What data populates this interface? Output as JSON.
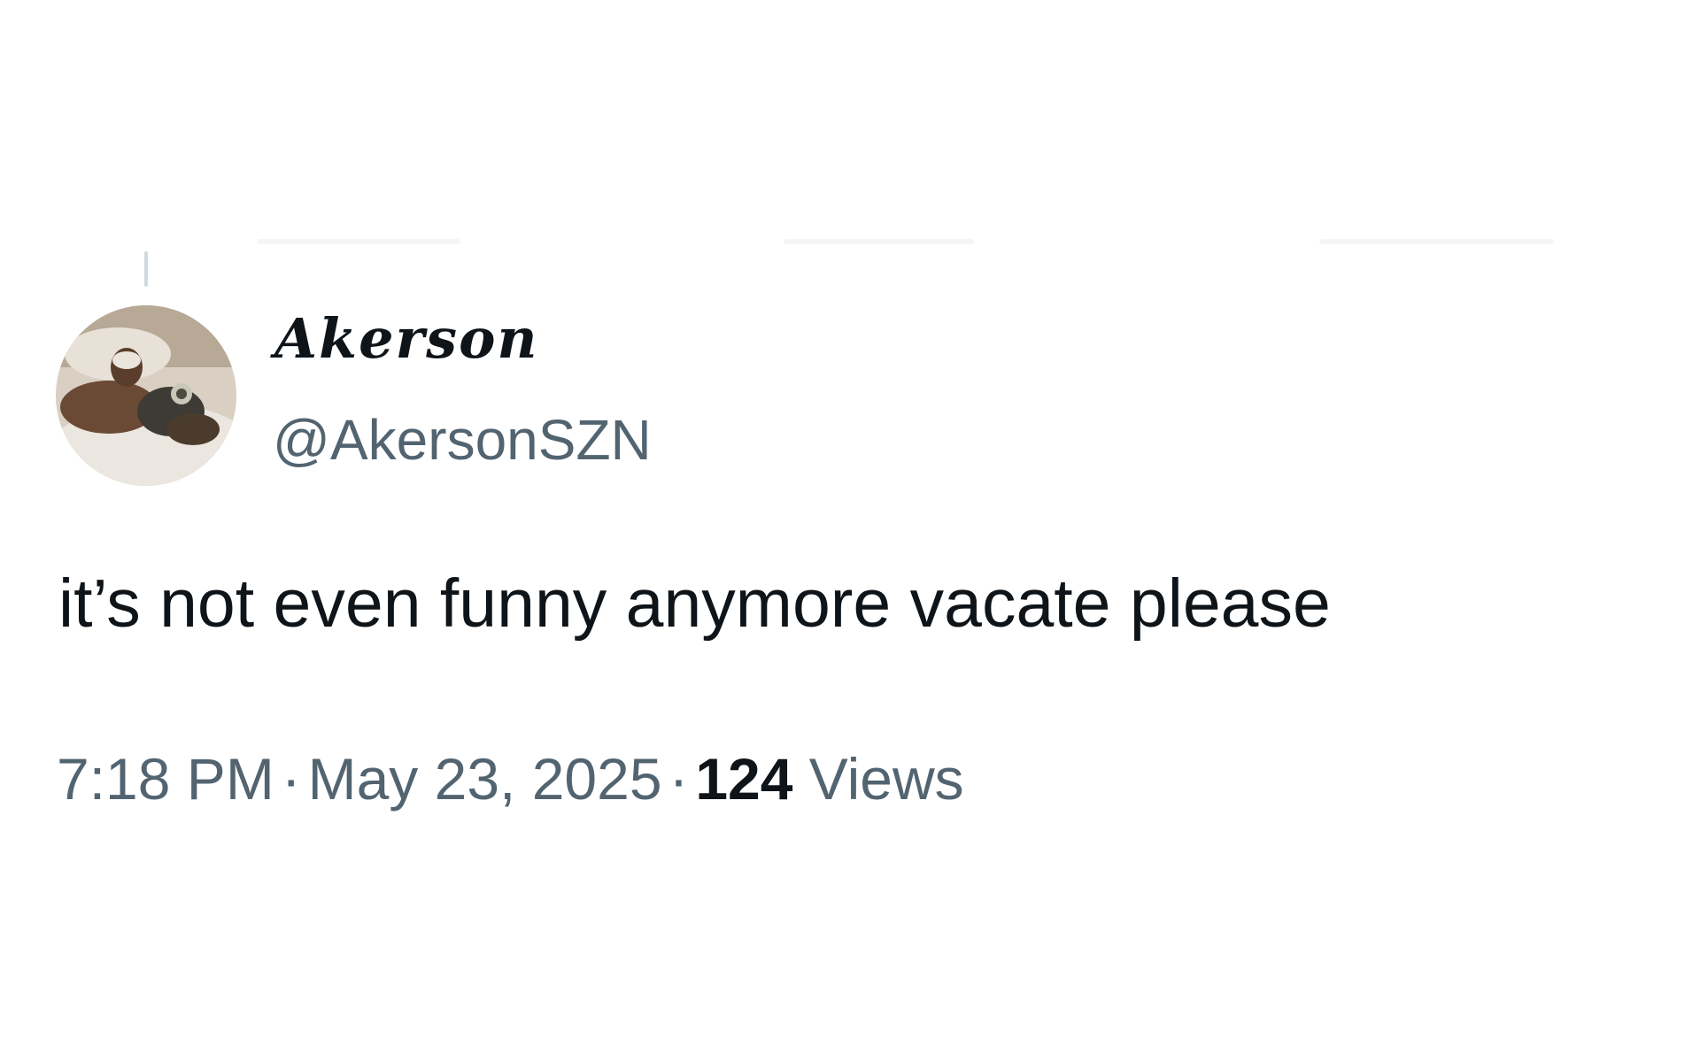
{
  "tweet": {
    "author": {
      "display_name": "Akerson",
      "handle": "@AkersonSZN",
      "avatar_icon": "profile-photo-avatar"
    },
    "text": "it’s not even funny anymore vacate please",
    "time": "7:18 PM",
    "separator": "·",
    "date": "May 23, 2025",
    "views_count": "124",
    "views_label": "Views"
  },
  "colors": {
    "primary_text": "#0f1419",
    "secondary_text": "#536471",
    "thread_line": "#cfd9de",
    "background": "#ffffff"
  }
}
